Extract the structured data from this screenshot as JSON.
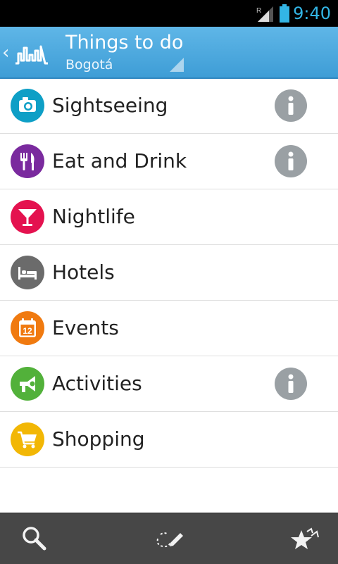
{
  "status_bar": {
    "time": "9:40",
    "roaming_indicator": "R",
    "icons": [
      "signal-icon",
      "battery-icon"
    ]
  },
  "action_bar": {
    "title": "Things to do",
    "subtitle": "Bogotá",
    "back_icon": "chevron-left-icon",
    "logo_icon": "city-skyline-logo-icon",
    "spinner_icon": "dropdown-triangle-icon"
  },
  "categories": [
    {
      "label": "Sightseeing",
      "icon": "camera-icon",
      "color": "#0e9fc6",
      "has_info": true
    },
    {
      "label": "Eat and Drink",
      "icon": "fork-knife-icon",
      "color": "#7a2a9e",
      "has_info": true
    },
    {
      "label": "Nightlife",
      "icon": "cocktail-glass-icon",
      "color": "#e4124f",
      "has_info": false
    },
    {
      "label": "Hotels",
      "icon": "bed-icon",
      "color": "#6b6b6b",
      "has_info": false
    },
    {
      "label": "Events",
      "icon": "calendar-icon",
      "calendar_day": "12",
      "color": "#f07a10",
      "has_info": false
    },
    {
      "label": "Activities",
      "icon": "megaphone-icon",
      "color": "#52b13a",
      "has_info": true
    },
    {
      "label": "Shopping",
      "icon": "shopping-cart-icon",
      "color": "#f2b705",
      "has_info": false
    }
  ],
  "info_icon": "info-icon",
  "info_color": "#9aa0a4",
  "bottom_bar": {
    "buttons": [
      "search-icon",
      "draw-route-icon",
      "favorites-stars-icon"
    ]
  },
  "colors": {
    "status_clock": "#33b5e5",
    "action_bar": "#4aa8dd",
    "bottom_bar": "#474747"
  }
}
